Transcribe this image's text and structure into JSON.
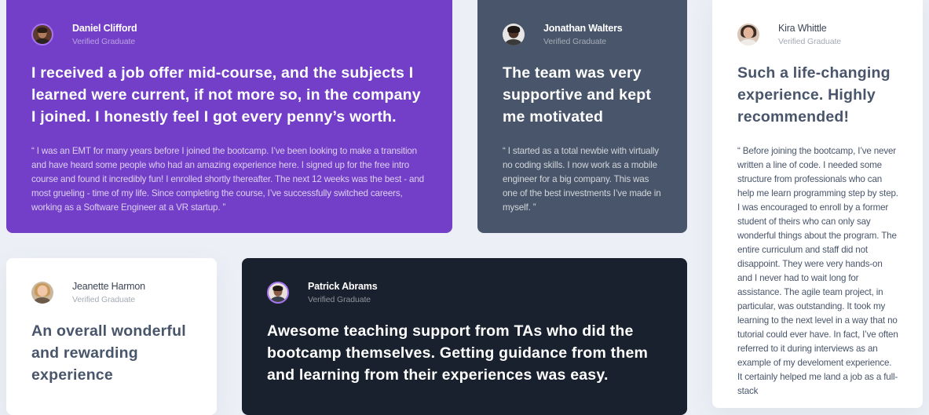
{
  "testimonials": [
    {
      "name": "Daniel Clifford",
      "status": "Verified Graduate",
      "headline": "I received a job offer mid-course, and the subjects I learned were current, if not more so, in the company I joined. I honestly feel I got every penny’s worth.",
      "quote": "“ I was an EMT for many years before I joined the bootcamp. I’ve been looking to make a transition and have heard some people who had an amazing experience here. I signed up for the free intro course and found it incredibly fun! I enrolled shortly thereafter. The next 12 weeks was the best - and most grueling - time of my life. Since completing the course, I’ve successfully switched careers, working as a Software Engineer at a VR startup. ”",
      "background": "#733fc8"
    },
    {
      "name": "Jonathan Walters",
      "status": "Verified Graduate",
      "headline": "The team was very supportive and kept me motivated",
      "quote": "“ I started as a total newbie with virtually no coding skills. I now work as a mobile engineer for a big company. This was one of the best investments I’ve made in myself. ”",
      "background": "#48556a"
    },
    {
      "name": "Kira Whittle",
      "status": "Verified Graduate",
      "headline": "Such a life-changing experience. Highly recommended!",
      "quote": "“ Before joining the bootcamp, I’ve never written a line of code. I needed some structure from professionals who can help me learn programming step by step. I was encouraged to enroll by a former student of theirs who can only say wonderful things about the program. The entire curriculum and staff did not disappoint. They were very hands-on and I never had to wait long for assistance. The agile team project, in particular, was outstanding. It took my learning to the next level in a way that no tutorial could ever have. In fact, I’ve often referred to it during interviews as an example of my develoment experience. It certainly helped me land a job as a full-stack",
      "background": "#ffffff"
    },
    {
      "name": "Jeanette Harmon",
      "status": "Verified Graduate",
      "headline": "An overall wonderful and rewarding experience",
      "background": "#ffffff"
    },
    {
      "name": "Patrick Abrams",
      "status": "Verified Graduate",
      "headline": "Awesome teaching support from TAs who did the bootcamp themselves. Getting guidance from them and learning from their experiences was easy.",
      "background": "#19212e"
    }
  ],
  "icons": {
    "daniel": "avatar-daniel-clifford",
    "jonathan": "avatar-jonathan-walters",
    "kira": "avatar-kira-whittle",
    "jeanette": "avatar-jeanette-harmon",
    "patrick": "avatar-patrick-abrams"
  }
}
